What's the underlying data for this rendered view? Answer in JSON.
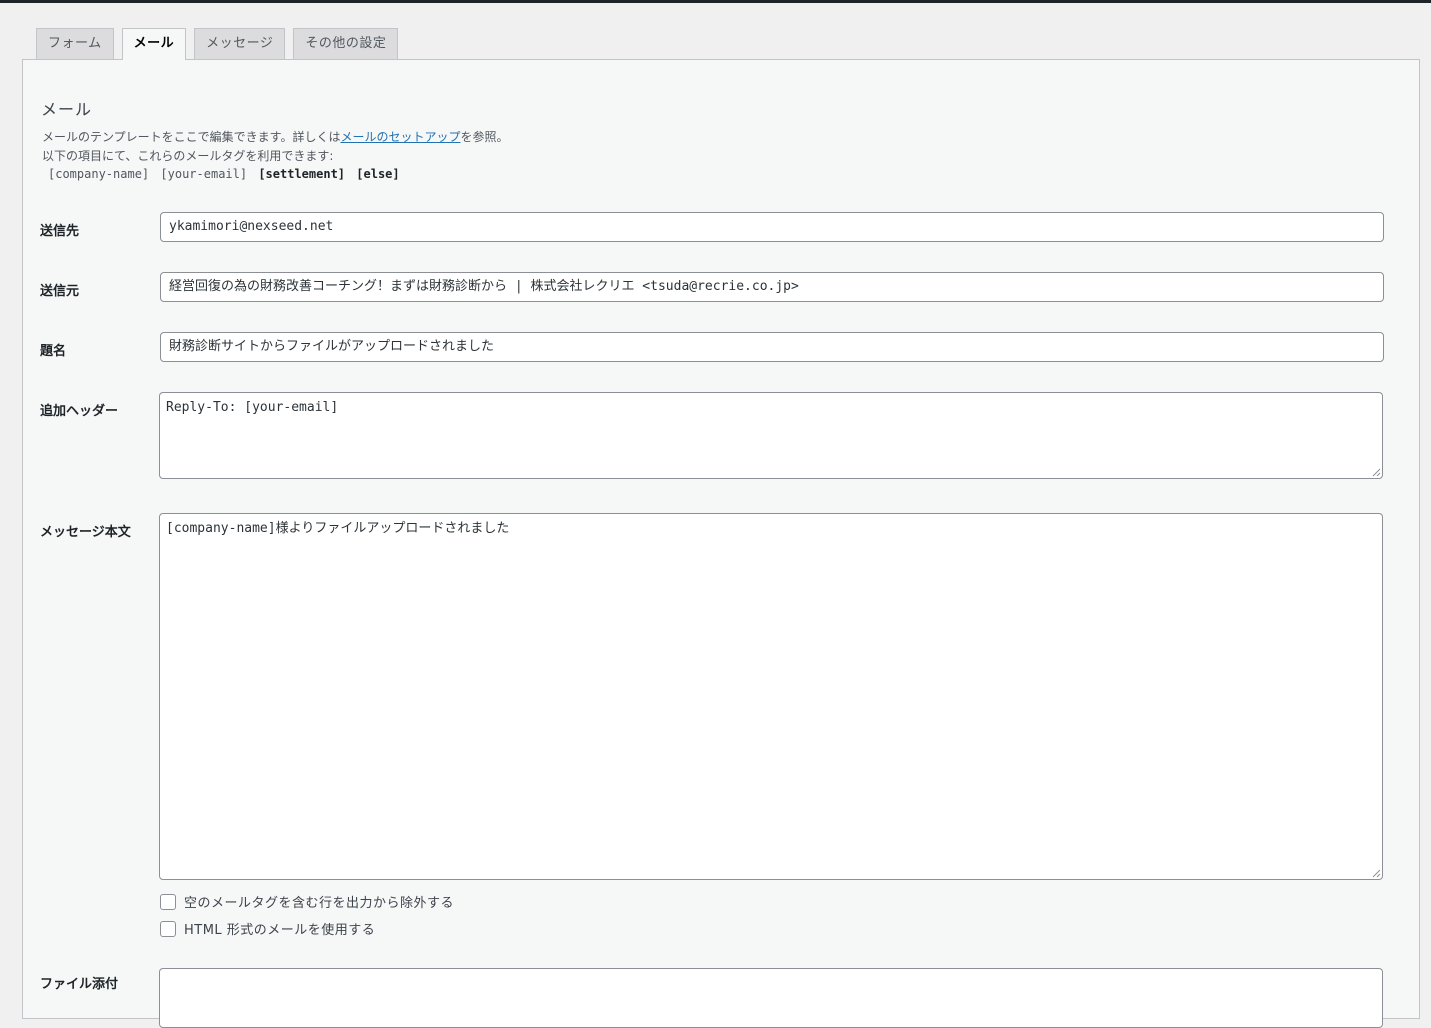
{
  "tabs": [
    {
      "label": "フォーム"
    },
    {
      "label": "メール"
    },
    {
      "label": "メッセージ"
    },
    {
      "label": "その他の設定"
    }
  ],
  "panel": {
    "title": "メール",
    "desc_line1_prefix": "メールのテンプレートをここで編集できます。詳しくは",
    "desc_link": "メールのセットアップ",
    "desc_line1_suffix": "を参照。",
    "desc_line2": "以下の項目にて、これらのメールタグを利用できます:",
    "tags": [
      "[company-name]",
      "[your-email]",
      "[settlement]",
      "[else]"
    ]
  },
  "fields": {
    "to": {
      "label": "送信先",
      "value": "ykamimori@nexseed.net"
    },
    "from": {
      "label": "送信元",
      "value": "経営回復の為の財務改善コーチング！まずは財務診断から | 株式会社レクリエ <tsuda@recrie.co.jp>"
    },
    "subject": {
      "label": "題名",
      "value": "財務診断サイトからファイルがアップロードされました"
    },
    "headers": {
      "label": "追加ヘッダー",
      "value": "Reply-To: [your-email]"
    },
    "body": {
      "label": "メッセージ本文",
      "value": "[company-name]様よりファイルアップロードされました"
    }
  },
  "options": {
    "exclude_blank": "空のメールタグを含む行を出力から除外する",
    "use_html": "HTML 形式のメールを使用する"
  },
  "attachments": {
    "label": "ファイル添付"
  }
}
